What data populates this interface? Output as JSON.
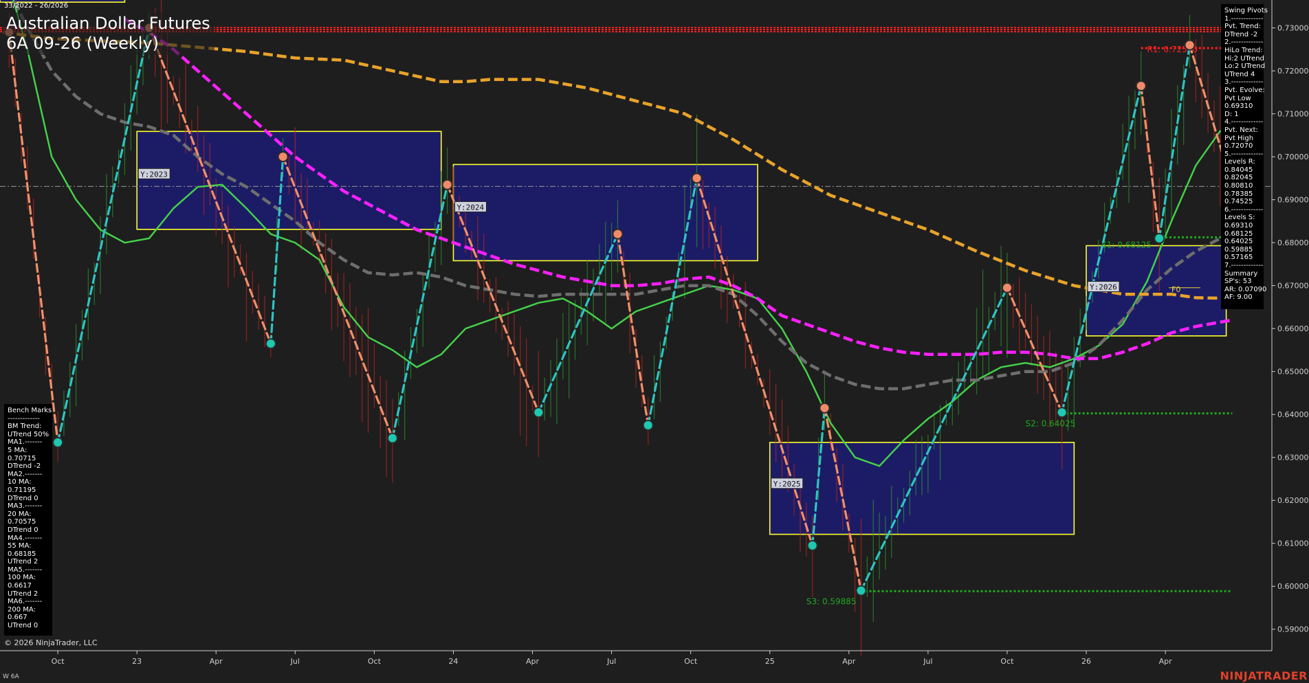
{
  "header": {
    "date_range": "33/2022 - 26/2026",
    "title_line1": "Australian Dollar Futures",
    "title_line2": "6A 09-26 (Weekly)"
  },
  "footer": {
    "copyright": "© 2026 NinjaTrader, LLC",
    "instrument_code": "W 6A",
    "brand": "NINJATRADER"
  },
  "swing_panel": {
    "lines": [
      "Swing Pivots",
      "1.-------------",
      "Pvt. Trend:",
      "DTrend -2",
      "2.-------------",
      "HiLo Trend:",
      "Hi:2 UTrend",
      "Lo:2 UTrend",
      "UTrend 4",
      "3.-------------",
      "Pvt. Evolve:",
      "Pvt Low",
      "0.69310",
      "D: 1",
      "4.-------------",
      "Pvt. Next:",
      "Pvt High",
      "0.72070",
      "5.-------------",
      "Levels R:",
      "0.84045",
      "0.82045",
      "0.80810",
      "0.78385",
      "0.74525",
      "6.-------------",
      "Levels S:",
      "0.69310",
      "0.68125",
      "0.64025",
      "0.59885",
      "0.57165",
      "7.-------------",
      "Summary",
      "SP's: 53",
      "AR: 0.07090",
      "AF: 9.00"
    ]
  },
  "bench_panel": {
    "lines": [
      "Bench Marks",
      "-------------",
      "BM Trend:",
      "UTrend 50%",
      "MA1.-------",
      "5 MA:",
      "0.70715",
      "DTrend -2",
      "MA2.-------",
      "10 MA:",
      "0.71195",
      "DTrend 0",
      "MA3.-------",
      "20 MA:",
      "0.70575",
      "DTrend 0",
      "MA4.-------",
      "55 MA:",
      "0.68185",
      "UTrend 2",
      "MA5.-------",
      "100 MA:",
      "0.6617",
      "UTrend 2",
      "MA6.-------",
      "200 MA:",
      "0.667",
      "UTrend 0"
    ]
  },
  "colors": {
    "background": "#1e1e1e",
    "up_swing": "#2ec4c4",
    "down_swing": "#f0906a",
    "ma_fast": "#44d04a",
    "ma_mid": "#6e6e6e",
    "ma_magenta": "#ff20ff",
    "ma_orange": "#e8a32a",
    "resistance": "#ff2020",
    "support": "#1fa81f",
    "year_box_fill": "#1c1c6e",
    "year_box_edge": "#ffff30"
  },
  "chart_data": {
    "type": "line",
    "title": "Australian Dollar Futures 6A 09-26 (Weekly)",
    "ylim": [
      0.585,
      0.7365
    ],
    "y_ticks": [
      "0.73000",
      "0.72000",
      "0.71000",
      "0.70000",
      "0.69000",
      "0.68000",
      "0.67000",
      "0.66000",
      "0.65000",
      "0.64000",
      "0.63000",
      "0.62000",
      "0.61000",
      "0.60000",
      "0.59000"
    ],
    "x_ticks": [
      {
        "label": "Oct",
        "week": 5
      },
      {
        "label": "23",
        "week": 18
      },
      {
        "label": "Apr",
        "week": 31
      },
      {
        "label": "Jul",
        "week": 44
      },
      {
        "label": "Oct",
        "week": 57
      },
      {
        "label": "24",
        "week": 70
      },
      {
        "label": "Apr",
        "week": 83
      },
      {
        "label": "Jul",
        "week": 96
      },
      {
        "label": "Oct",
        "week": 109
      },
      {
        "label": "25",
        "week": 122
      },
      {
        "label": "Apr",
        "week": 135
      },
      {
        "label": "Jul",
        "week": 148
      },
      {
        "label": "Oct",
        "week": 161
      },
      {
        "label": "26",
        "week": 174
      },
      {
        "label": "Apr",
        "week": 187
      }
    ],
    "x_range": [
      -4.5,
      204.5
    ],
    "swing_pivots": [
      {
        "week": -3,
        "price": 0.729,
        "type": "high"
      },
      {
        "week": 5,
        "price": 0.6335,
        "type": "low"
      },
      {
        "week": 20,
        "price": 0.73,
        "type": "high"
      },
      {
        "week": 40,
        "price": 0.6565,
        "type": "low"
      },
      {
        "week": 42,
        "price": 0.7,
        "type": "high"
      },
      {
        "week": 60,
        "price": 0.6345,
        "type": "low"
      },
      {
        "week": 69,
        "price": 0.6935,
        "type": "high"
      },
      {
        "week": 84,
        "price": 0.6405,
        "type": "low"
      },
      {
        "week": 97,
        "price": 0.682,
        "type": "high"
      },
      {
        "week": 102,
        "price": 0.6375,
        "type": "low"
      },
      {
        "week": 110,
        "price": 0.695,
        "type": "high"
      },
      {
        "week": 129,
        "price": 0.6095,
        "type": "low"
      },
      {
        "week": 131,
        "price": 0.6415,
        "type": "high"
      },
      {
        "week": 137,
        "price": 0.599,
        "type": "low"
      },
      {
        "week": 161,
        "price": 0.6695,
        "type": "high"
      },
      {
        "week": 170,
        "price": 0.6405,
        "type": "low"
      },
      {
        "week": 183,
        "price": 0.7165,
        "type": "high"
      },
      {
        "week": 186,
        "price": 0.681,
        "type": "low"
      },
      {
        "week": 191,
        "price": 0.726,
        "type": "high"
      },
      {
        "week": 198,
        "price": 0.6931,
        "type": "low"
      }
    ],
    "series": [
      {
        "name": "5 MA",
        "color": "#44d04a",
        "points": [
          [
            -4,
            0.745
          ],
          [
            0,
            0.725
          ],
          [
            4,
            0.7
          ],
          [
            8,
            0.69
          ],
          [
            12,
            0.683
          ],
          [
            16,
            0.68
          ],
          [
            20,
            0.681
          ],
          [
            24,
            0.688
          ],
          [
            28,
            0.693
          ],
          [
            32,
            0.6935
          ],
          [
            36,
            0.688
          ],
          [
            40,
            0.682
          ],
          [
            44,
            0.68
          ],
          [
            48,
            0.676
          ],
          [
            52,
            0.665
          ],
          [
            56,
            0.658
          ],
          [
            60,
            0.655
          ],
          [
            64,
            0.651
          ],
          [
            68,
            0.654
          ],
          [
            72,
            0.66
          ],
          [
            76,
            0.662
          ],
          [
            80,
            0.664
          ],
          [
            84,
            0.666
          ],
          [
            88,
            0.667
          ],
          [
            92,
            0.664
          ],
          [
            96,
            0.66
          ],
          [
            100,
            0.664
          ],
          [
            104,
            0.666
          ],
          [
            108,
            0.668
          ],
          [
            112,
            0.67
          ],
          [
            116,
            0.669
          ],
          [
            120,
            0.667
          ],
          [
            124,
            0.66
          ],
          [
            128,
            0.65
          ],
          [
            132,
            0.638
          ],
          [
            136,
            0.63
          ],
          [
            140,
            0.628
          ],
          [
            144,
            0.634
          ],
          [
            148,
            0.639
          ],
          [
            152,
            0.643
          ],
          [
            156,
            0.648
          ],
          [
            160,
            0.651
          ],
          [
            164,
            0.652
          ],
          [
            168,
            0.651
          ],
          [
            172,
            0.653
          ],
          [
            176,
            0.656
          ],
          [
            180,
            0.661
          ],
          [
            184,
            0.671
          ],
          [
            188,
            0.685
          ],
          [
            192,
            0.698
          ],
          [
            196,
            0.706
          ],
          [
            198,
            0.706
          ]
        ]
      },
      {
        "name": "100 MA",
        "color": "#6e6e6e",
        "points": [
          [
            -4,
            0.742
          ],
          [
            0,
            0.73
          ],
          [
            4,
            0.72
          ],
          [
            8,
            0.714
          ],
          [
            12,
            0.71
          ],
          [
            16,
            0.708
          ],
          [
            20,
            0.707
          ],
          [
            24,
            0.705
          ],
          [
            28,
            0.7
          ],
          [
            32,
            0.696
          ],
          [
            36,
            0.693
          ],
          [
            40,
            0.689
          ],
          [
            44,
            0.685
          ],
          [
            48,
            0.68
          ],
          [
            52,
            0.676
          ],
          [
            56,
            0.673
          ],
          [
            60,
            0.6725
          ],
          [
            64,
            0.673
          ],
          [
            68,
            0.672
          ],
          [
            72,
            0.67
          ],
          [
            76,
            0.669
          ],
          [
            80,
            0.668
          ],
          [
            84,
            0.6675
          ],
          [
            88,
            0.668
          ],
          [
            92,
            0.668
          ],
          [
            96,
            0.668
          ],
          [
            100,
            0.668
          ],
          [
            104,
            0.669
          ],
          [
            108,
            0.67
          ],
          [
            112,
            0.67
          ],
          [
            116,
            0.668
          ],
          [
            120,
            0.663
          ],
          [
            124,
            0.657
          ],
          [
            128,
            0.652
          ],
          [
            132,
            0.649
          ],
          [
            136,
            0.647
          ],
          [
            140,
            0.646
          ],
          [
            144,
            0.646
          ],
          [
            148,
            0.647
          ],
          [
            152,
            0.648
          ],
          [
            156,
            0.648
          ],
          [
            160,
            0.649
          ],
          [
            164,
            0.65
          ],
          [
            168,
            0.65
          ],
          [
            172,
            0.652
          ],
          [
            176,
            0.656
          ],
          [
            180,
            0.662
          ],
          [
            184,
            0.669
          ],
          [
            188,
            0.674
          ],
          [
            192,
            0.678
          ],
          [
            196,
            0.681
          ],
          [
            198,
            0.6815
          ]
        ]
      },
      {
        "name": "55 MA",
        "color": "#ff20ff",
        "points": [
          [
            16,
            0.732
          ],
          [
            20,
            0.729
          ],
          [
            24,
            0.725
          ],
          [
            28,
            0.72
          ],
          [
            32,
            0.715
          ],
          [
            36,
            0.71
          ],
          [
            40,
            0.705
          ],
          [
            44,
            0.7
          ],
          [
            48,
            0.696
          ],
          [
            52,
            0.692
          ],
          [
            56,
            0.689
          ],
          [
            60,
            0.686
          ],
          [
            64,
            0.683
          ],
          [
            68,
            0.681
          ],
          [
            72,
            0.679
          ],
          [
            76,
            0.677
          ],
          [
            80,
            0.675
          ],
          [
            84,
            0.6735
          ],
          [
            88,
            0.672
          ],
          [
            92,
            0.671
          ],
          [
            96,
            0.67
          ],
          [
            100,
            0.67
          ],
          [
            104,
            0.6705
          ],
          [
            108,
            0.6715
          ],
          [
            112,
            0.672
          ],
          [
            116,
            0.67
          ],
          [
            120,
            0.667
          ],
          [
            124,
            0.663
          ],
          [
            128,
            0.661
          ],
          [
            132,
            0.659
          ],
          [
            136,
            0.657
          ],
          [
            140,
            0.6555
          ],
          [
            144,
            0.6545
          ],
          [
            148,
            0.654
          ],
          [
            152,
            0.654
          ],
          [
            156,
            0.654
          ],
          [
            160,
            0.6545
          ],
          [
            164,
            0.6545
          ],
          [
            168,
            0.654
          ],
          [
            172,
            0.653
          ],
          [
            176,
            0.653
          ],
          [
            180,
            0.6545
          ],
          [
            184,
            0.6565
          ],
          [
            188,
            0.659
          ],
          [
            192,
            0.6605
          ],
          [
            196,
            0.6615
          ],
          [
            198,
            0.662
          ]
        ]
      },
      {
        "name": "200 MA",
        "color": "#e8a32a",
        "points": [
          [
            -4,
            0.729
          ],
          [
            4,
            0.7275
          ],
          [
            12,
            0.727
          ],
          [
            20,
            0.7265
          ],
          [
            28,
            0.7255
          ],
          [
            36,
            0.7245
          ],
          [
            44,
            0.723
          ],
          [
            52,
            0.7225
          ],
          [
            60,
            0.72
          ],
          [
            68,
            0.7175
          ],
          [
            72,
            0.7175
          ],
          [
            76,
            0.718
          ],
          [
            84,
            0.718
          ],
          [
            92,
            0.716
          ],
          [
            100,
            0.713
          ],
          [
            108,
            0.71
          ],
          [
            116,
            0.704
          ],
          [
            124,
            0.697
          ],
          [
            132,
            0.691
          ],
          [
            140,
            0.687
          ],
          [
            148,
            0.683
          ],
          [
            156,
            0.678
          ],
          [
            164,
            0.6735
          ],
          [
            172,
            0.67
          ],
          [
            180,
            0.668
          ],
          [
            188,
            0.668
          ],
          [
            192,
            0.6672
          ],
          [
            198,
            0.667
          ]
        ]
      }
    ],
    "levels": [
      {
        "label": "R1: 0.72530",
        "price": 0.7253,
        "from": 183,
        "to": 198,
        "color": "#ff2020"
      },
      {
        "label": "S1: 0.68125",
        "price": 0.68125,
        "from": 187,
        "to": 198,
        "color": "#1fa81f"
      },
      {
        "label": "S2: 0.64025",
        "price": 0.64025,
        "from": 170,
        "to": 198,
        "color": "#1fa81f"
      },
      {
        "label": "S3: 0.59885",
        "price": 0.59885,
        "from": 137,
        "to": 198,
        "color": "#1fa81f"
      }
    ],
    "top_resistance": {
      "price": 0.7296,
      "from": -4.5,
      "to": 198
    },
    "current_price": 0.6931,
    "year_boxes": [
      {
        "label": "Y:2023",
        "week_start": 18,
        "week_end": 68,
        "high": 0.7059,
        "low": 0.6831
      },
      {
        "label": "Y:2024",
        "week_start": 70,
        "week_end": 120,
        "high": 0.6982,
        "low": 0.6758
      },
      {
        "label": "Y:2025",
        "week_start": 122,
        "week_end": 172,
        "high": 0.6335,
        "low": 0.6121
      },
      {
        "label": "Y:2026",
        "week_start": 174,
        "week_end": 197,
        "high": 0.6793,
        "low": 0.6583
      },
      {
        "label": "",
        "week_start": -4.5,
        "week_end": 16,
        "high": 0.74,
        "low": 0.736
      }
    ],
    "f0_label": "F0"
  }
}
